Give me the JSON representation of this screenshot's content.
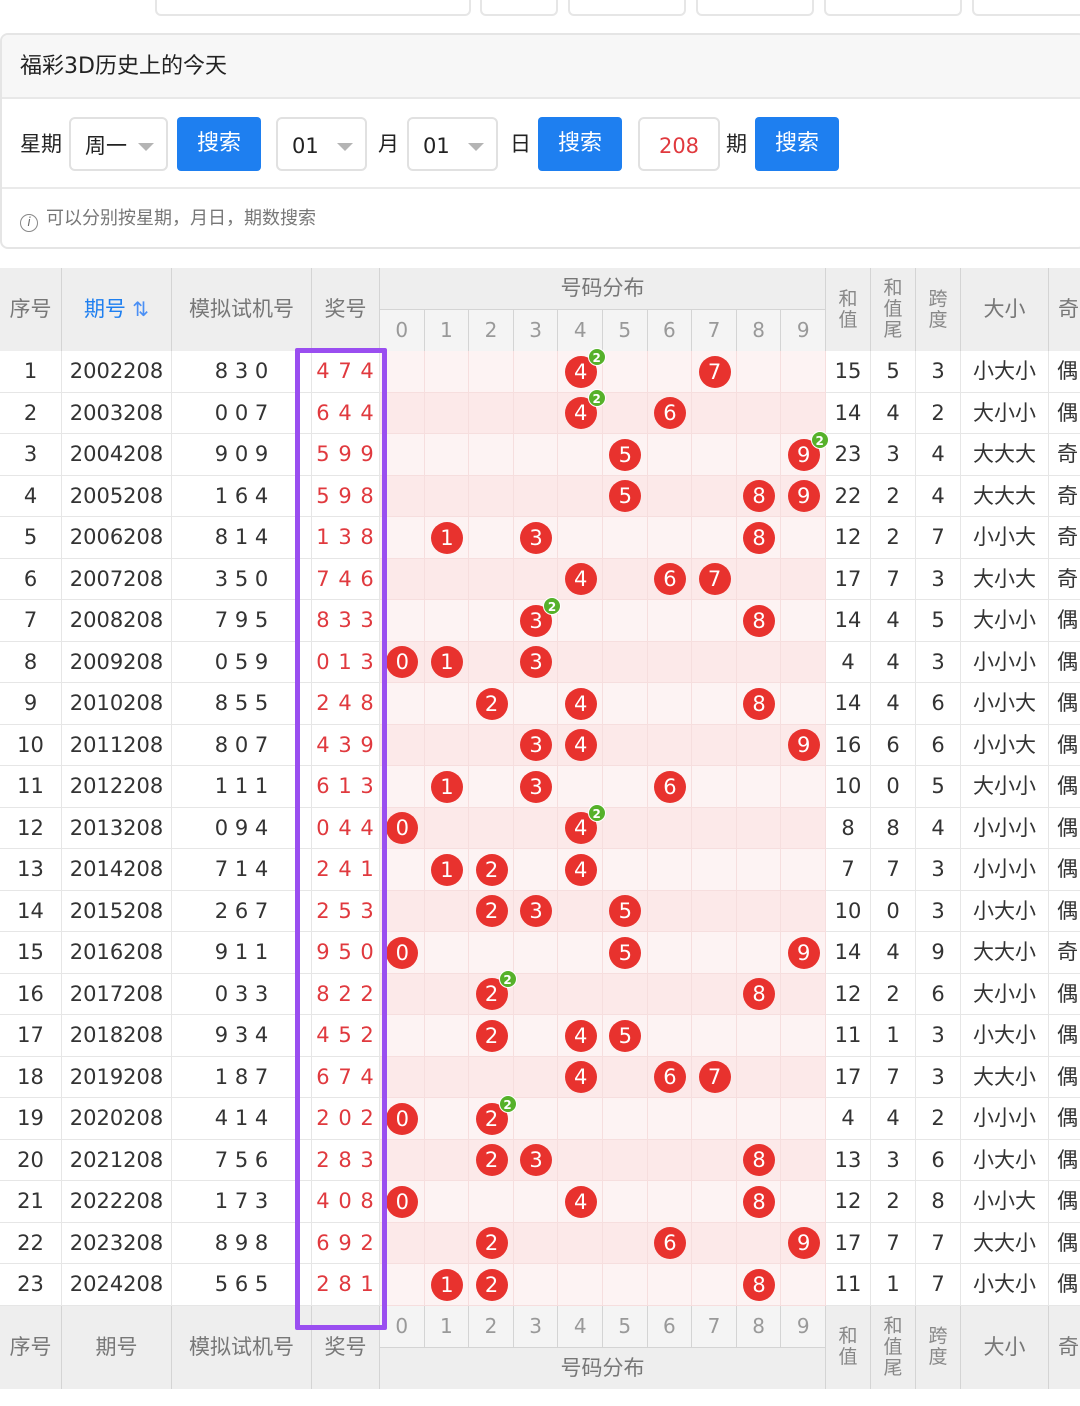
{
  "panel": {
    "title": "福彩3D历史上的今天",
    "weekday_label": "星期",
    "weekday_value": "周一",
    "search_label": "搜索",
    "month_value": "01",
    "month_label": "月",
    "day_value": "01",
    "day_label": "日",
    "issue_value": "208",
    "issue_label": "期",
    "hint": "可以分别按星期，月日，期数搜索"
  },
  "table": {
    "headers": {
      "index": "序号",
      "issue": "期号",
      "sim": "模拟试机号",
      "prize": "奖号",
      "dist": "号码分布",
      "sum": [
        "和",
        "值"
      ],
      "tail": [
        "和",
        "值",
        "尾"
      ],
      "span": [
        "跨",
        "度"
      ],
      "size": "大小",
      "parity": "奇"
    },
    "digits": [
      "0",
      "1",
      "2",
      "3",
      "4",
      "5",
      "6",
      "7",
      "8",
      "9"
    ],
    "sort_icon": "sort-icon",
    "colors": {
      "accent": "#1e7ff0",
      "ball": "#e8322e",
      "repeat": "#56b12a",
      "highlight": "#9a4ef0",
      "prize": "#e0393e"
    },
    "rows": [
      {
        "i": "1",
        "issue": "2002208",
        "sim": "8 3 0",
        "prize": "4 7 4",
        "sum": "15",
        "tail": "5",
        "span": "3",
        "size": "小大小",
        "parity": "偶"
      },
      {
        "i": "2",
        "issue": "2003208",
        "sim": "0 0 7",
        "prize": "6 4 4",
        "sum": "14",
        "tail": "4",
        "span": "2",
        "size": "大小小",
        "parity": "偶"
      },
      {
        "i": "3",
        "issue": "2004208",
        "sim": "9 0 9",
        "prize": "5 9 9",
        "sum": "23",
        "tail": "3",
        "span": "4",
        "size": "大大大",
        "parity": "奇"
      },
      {
        "i": "4",
        "issue": "2005208",
        "sim": "1 6 4",
        "prize": "5 9 8",
        "sum": "22",
        "tail": "2",
        "span": "4",
        "size": "大大大",
        "parity": "奇"
      },
      {
        "i": "5",
        "issue": "2006208",
        "sim": "8 1 4",
        "prize": "1 3 8",
        "sum": "12",
        "tail": "2",
        "span": "7",
        "size": "小小大",
        "parity": "奇"
      },
      {
        "i": "6",
        "issue": "2007208",
        "sim": "3 5 0",
        "prize": "7 4 6",
        "sum": "17",
        "tail": "7",
        "span": "3",
        "size": "大小大",
        "parity": "奇"
      },
      {
        "i": "7",
        "issue": "2008208",
        "sim": "7 9 5",
        "prize": "8 3 3",
        "sum": "14",
        "tail": "4",
        "span": "5",
        "size": "大小小",
        "parity": "偶"
      },
      {
        "i": "8",
        "issue": "2009208",
        "sim": "0 5 9",
        "prize": "0 1 3",
        "sum": "4",
        "tail": "4",
        "span": "3",
        "size": "小小小",
        "parity": "偶"
      },
      {
        "i": "9",
        "issue": "2010208",
        "sim": "8 5 5",
        "prize": "2 4 8",
        "sum": "14",
        "tail": "4",
        "span": "6",
        "size": "小小大",
        "parity": "偶"
      },
      {
        "i": "10",
        "issue": "2011208",
        "sim": "8 0 7",
        "prize": "4 3 9",
        "sum": "16",
        "tail": "6",
        "span": "6",
        "size": "小小大",
        "parity": "偶"
      },
      {
        "i": "11",
        "issue": "2012208",
        "sim": "1 1 1",
        "prize": "6 1 3",
        "sum": "10",
        "tail": "0",
        "span": "5",
        "size": "大小小",
        "parity": "偶"
      },
      {
        "i": "12",
        "issue": "2013208",
        "sim": "0 9 4",
        "prize": "0 4 4",
        "sum": "8",
        "tail": "8",
        "span": "4",
        "size": "小小小",
        "parity": "偶"
      },
      {
        "i": "13",
        "issue": "2014208",
        "sim": "7 1 4",
        "prize": "2 4 1",
        "sum": "7",
        "tail": "7",
        "span": "3",
        "size": "小小小",
        "parity": "偶"
      },
      {
        "i": "14",
        "issue": "2015208",
        "sim": "2 6 7",
        "prize": "2 5 3",
        "sum": "10",
        "tail": "0",
        "span": "3",
        "size": "小大小",
        "parity": "偶"
      },
      {
        "i": "15",
        "issue": "2016208",
        "sim": "9 1 1",
        "prize": "9 5 0",
        "sum": "14",
        "tail": "4",
        "span": "9",
        "size": "大大小",
        "parity": "奇"
      },
      {
        "i": "16",
        "issue": "2017208",
        "sim": "0 3 3",
        "prize": "8 2 2",
        "sum": "12",
        "tail": "2",
        "span": "6",
        "size": "大小小",
        "parity": "偶"
      },
      {
        "i": "17",
        "issue": "2018208",
        "sim": "9 3 4",
        "prize": "4 5 2",
        "sum": "11",
        "tail": "1",
        "span": "3",
        "size": "小大小",
        "parity": "偶"
      },
      {
        "i": "18",
        "issue": "2019208",
        "sim": "1 8 7",
        "prize": "6 7 4",
        "sum": "17",
        "tail": "7",
        "span": "3",
        "size": "大大小",
        "parity": "偶"
      },
      {
        "i": "19",
        "issue": "2020208",
        "sim": "4 1 4",
        "prize": "2 0 2",
        "sum": "4",
        "tail": "4",
        "span": "2",
        "size": "小小小",
        "parity": "偶"
      },
      {
        "i": "20",
        "issue": "2021208",
        "sim": "7 5 6",
        "prize": "2 8 3",
        "sum": "13",
        "tail": "3",
        "span": "6",
        "size": "小大小",
        "parity": "偶"
      },
      {
        "i": "21",
        "issue": "2022208",
        "sim": "1 7 3",
        "prize": "4 0 8",
        "sum": "12",
        "tail": "2",
        "span": "8",
        "size": "小小大",
        "parity": "偶"
      },
      {
        "i": "22",
        "issue": "2023208",
        "sim": "8 9 8",
        "prize": "6 9 2",
        "sum": "17",
        "tail": "7",
        "span": "7",
        "size": "大大小",
        "parity": "偶"
      },
      {
        "i": "23",
        "issue": "2024208",
        "sim": "5 6 5",
        "prize": "2 8 1",
        "sum": "11",
        "tail": "1",
        "span": "7",
        "size": "小大小",
        "parity": "偶"
      }
    ]
  }
}
